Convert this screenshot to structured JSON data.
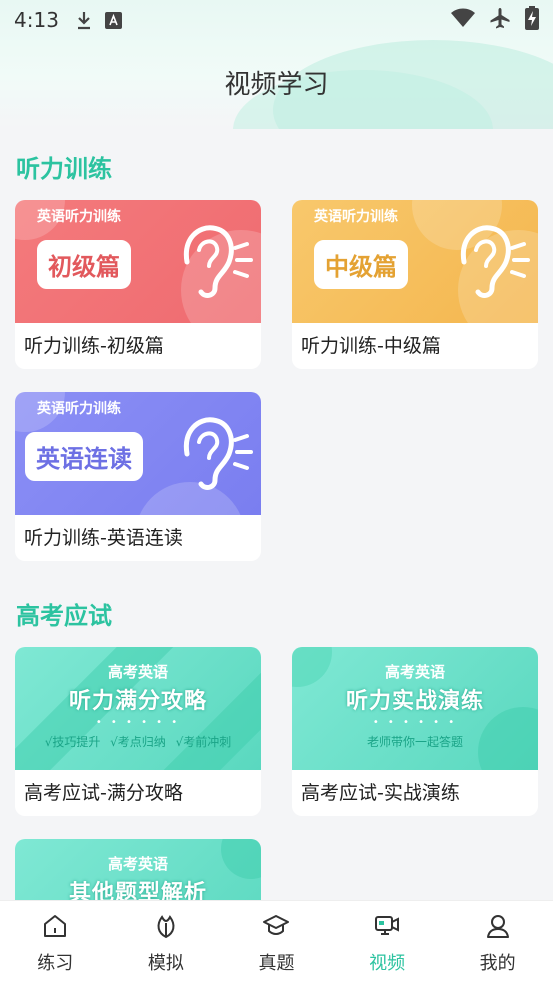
{
  "status_bar": {
    "time": "4:13"
  },
  "header": {
    "title": "视频学习"
  },
  "sections": [
    {
      "title": "听力训练",
      "cards": [
        {
          "banner_sub": "英语听力训练",
          "banner_tag": "初级篇",
          "label": "听力训练-初级篇",
          "theme": "#f07477"
        },
        {
          "banner_sub": "英语听力训练",
          "banner_tag": "中级篇",
          "label": "听力训练-中级篇",
          "theme": "#f5bd5a"
        },
        {
          "banner_sub": "英语听力训练",
          "banner_tag": "英语连读",
          "label": "听力训练-英语连读",
          "theme": "#8286f2"
        }
      ]
    },
    {
      "title": "高考应试",
      "cards": [
        {
          "banner_sub": "高考英语",
          "banner_title": "听力满分攻略",
          "banner_dots": "• • • • • •",
          "banner_tips": "√技巧提升 √考点归纳 √考前冲刺",
          "label": "高考应试-满分攻略",
          "theme": "#6ee0c9"
        },
        {
          "banner_sub": "高考英语",
          "banner_title": "听力实战演练",
          "banner_dots": "• • • • • •",
          "banner_tips": "老师带你一起答题",
          "label": "高考应试-实战演练",
          "theme": "#6ee0c9"
        },
        {
          "banner_sub": "高考英语",
          "banner_title": "其他题型解析",
          "label": "",
          "theme": "#6ee0c9"
        }
      ]
    }
  ],
  "tabbar": {
    "active": "视频",
    "items": [
      {
        "label": "练习",
        "icon": "home-icon"
      },
      {
        "label": "模拟",
        "icon": "leaf-icon"
      },
      {
        "label": "真题",
        "icon": "graduation-cap-icon"
      },
      {
        "label": "视频",
        "icon": "video-camera-icon"
      },
      {
        "label": "我的",
        "icon": "user-icon"
      }
    ]
  },
  "colors": {
    "accent": "#2cc3a0"
  }
}
